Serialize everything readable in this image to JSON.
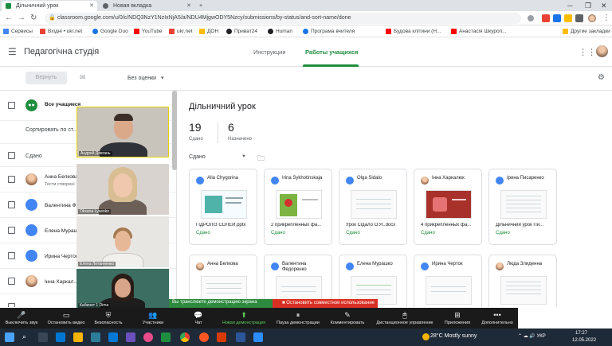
{
  "browser": {
    "tabs": [
      {
        "title": "Дільничний урок",
        "active": true
      },
      {
        "title": "Новая вкладка",
        "active": false
      }
    ],
    "new_tab_label": "+",
    "url": "classroom.google.com/u/0/c/NDQ3NzY1NzIxNjA5/a/NDU4MjgwODY5Nzcy/submissions/by-status/and-sort-name/done",
    "bookmarks": [
      "Сервисы",
      "Вхідні • ukr.net",
      "Google Duo",
      "YouTube",
      "ukr.net",
      "ДОН",
      "Приват24",
      "Human",
      "Програма вчителя",
      "Будова клітини (Н...",
      "Анастасія Шкуроп..."
    ],
    "other_bookmarks": "Другие закладки"
  },
  "classroom": {
    "title": "Педагогічна студія",
    "tabs": [
      "Инструкции",
      "Работы учащихся"
    ],
    "active_tab": "Работы учащихся",
    "return_button": "Вернуть",
    "grade_select": "Без оценки",
    "all_students": "Все учащиеся",
    "sort_label": "Сортировать по ст...",
    "section_label": "Сдано",
    "students": [
      {
        "name": "Анна Белкова",
        "sub": "Тести створені",
        "photo": true
      },
      {
        "name": "Валентина Ф...",
        "sub": "",
        "photo": false
      },
      {
        "name": "Елена Мураш...",
        "sub": "",
        "photo": false
      },
      {
        "name": "Ирина Черток",
        "sub": "",
        "photo": false
      },
      {
        "name": "Інна Харкал...",
        "sub": "",
        "photo": true
      }
    ]
  },
  "assignment": {
    "title": "Дільничний урок",
    "stats": [
      {
        "value": "19",
        "label": "Сдано"
      },
      {
        "value": "6",
        "label": "Назначено"
      }
    ],
    "filter": "Сдано",
    "cards": [
      {
        "name": "Alla Chygorina",
        "file": "ГІДРОЛІЗ СОЛЕЙ.pptx",
        "status": "Сдано",
        "photo": false,
        "thumb": "slide"
      },
      {
        "name": "Irina Sykhotinskaja",
        "file": "2 прикрепленных фа...",
        "status": "Сдано",
        "photo": false,
        "thumb": "flower"
      },
      {
        "name": "Olga Sidalo",
        "file": "Урок Сідало О.Я..docx",
        "status": "Сдано",
        "photo": false,
        "thumb": "doc"
      },
      {
        "name": "Інна Харкалюк",
        "file": "4 прикрепленных фа...",
        "status": "Сдано",
        "photo": true,
        "thumb": "red"
      },
      {
        "name": "Ірина Писаренко",
        "file": "Дільничний урок Пи...",
        "status": "Сдано",
        "photo": false,
        "thumb": "doc"
      },
      {
        "name": "Анна Белкова",
        "file": "",
        "status": "",
        "photo": true,
        "thumb": "doc"
      },
      {
        "name": "Валентина Федоренко",
        "file": "",
        "status": "",
        "photo": false,
        "thumb": "doc"
      },
      {
        "name": "Елена Мурашко",
        "file": "",
        "status": "",
        "photo": false,
        "thumb": "doc"
      },
      {
        "name": "Ирина Черток",
        "file": "",
        "status": "",
        "photo": false,
        "thumb": "doc"
      },
      {
        "name": "Люда Злиденна",
        "file": "",
        "status": "",
        "photo": true,
        "thumb": "doc"
      }
    ]
  },
  "zoom": {
    "participants": [
      {
        "name": "Андрей Довгань"
      },
      {
        "name": "Oksana Lysenko"
      },
      {
        "name": "Елена Литвиненко"
      },
      {
        "name": "Кабинет 1 Dima"
      }
    ],
    "share_status": "Вы транслюете демонстрацию экрана",
    "stop_share": "Остановить совместное использование",
    "toolbar": [
      {
        "label": "Выключить звук",
        "icon": "mic-icon"
      },
      {
        "label": "Остановить видео",
        "icon": "video-icon"
      },
      {
        "label": "Безопасность",
        "icon": "shield-icon"
      },
      {
        "label": "Участники",
        "icon": "participants-icon"
      },
      {
        "label": "Чат",
        "icon": "chat-icon"
      },
      {
        "label": "Новая демонстрация",
        "icon": "share-icon"
      },
      {
        "label": "Пауза демонстрации",
        "icon": "pause-icon"
      },
      {
        "label": "Комментировать",
        "icon": "annotate-icon"
      },
      {
        "label": "Дистанционное управление",
        "icon": "remote-icon"
      },
      {
        "label": "Приложения",
        "icon": "apps-icon"
      },
      {
        "label": "Дополнительно",
        "icon": "more-icon"
      }
    ]
  },
  "taskbar": {
    "weather": "28°C  Mostly sunny",
    "language": "УКР",
    "time": "17:27",
    "date": "12.05.2022"
  },
  "colors": {
    "classroom_green": "#1e8e3e",
    "zoom_stop_red": "#d93025",
    "zoom_share_green": "#2d8a3e"
  }
}
